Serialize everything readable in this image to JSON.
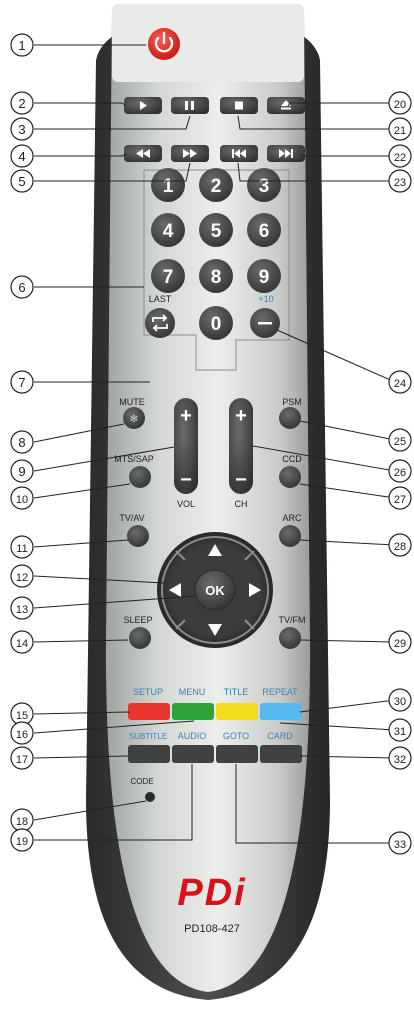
{
  "callouts": [
    "1",
    "2",
    "3",
    "4",
    "5",
    "6",
    "7",
    "8",
    "9",
    "10",
    "11",
    "12",
    "13",
    "14",
    "15",
    "16",
    "17",
    "18",
    "19",
    "20",
    "21",
    "22",
    "23",
    "24",
    "25",
    "26",
    "27",
    "28",
    "29",
    "30",
    "31",
    "32",
    "33"
  ],
  "digits": [
    "1",
    "2",
    "3",
    "4",
    "5",
    "6",
    "7",
    "8",
    "9",
    "0"
  ],
  "labels": {
    "last": "LAST",
    "plus10": "+10",
    "mute": "MUTE",
    "psm": "PSM",
    "mts_sap": "MTS/SAP",
    "ccd": "CCD",
    "vol": "VOL",
    "ch": "CH",
    "tv_av": "TV/AV",
    "arc": "ARC",
    "ok": "OK",
    "sleep": "SLEEP",
    "tv_fm": "TV/FM",
    "setup": "SETUP",
    "menu": "MENU",
    "title": "TITLE",
    "repeat": "REPEAT",
    "subtitle": "SUBTITLE",
    "audio": "AUDIO",
    "goto": "GOTO",
    "card": "CARD",
    "code": "CODE",
    "brand": "PDi",
    "model": "PD108-427"
  },
  "colors": {
    "body": "#c6c9c6",
    "frame": "#3b3d3b",
    "power": "#e0231c",
    "button": "#3f4240",
    "setup": "#e8352e",
    "menu": "#2ea33a",
    "title": "#f2dc1c",
    "repeat": "#55b8ee",
    "brand_red": "#d8121a"
  }
}
